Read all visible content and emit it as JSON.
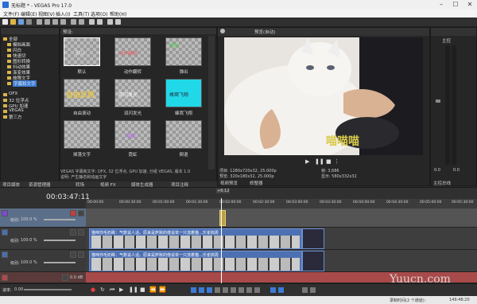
{
  "app": {
    "title": "无标题 * - VEGAS Pro 17.0"
  },
  "menu": [
    "文件(F)",
    "编辑(E)",
    "视图(V)",
    "插入(I)",
    "工具(T)",
    "选项(O)",
    "帮助(H)"
  ],
  "explorer": {
    "tree": [
      "全部",
      "模拟画面",
      "闪白",
      "快速切",
      "图形转换",
      "抖动效果",
      "渐变效果",
      "故障文字",
      "字幕和文字",
      "OFX",
      "32 位浮点",
      "GPU 加速",
      "VEGAS",
      "第三方"
    ],
    "info": "VEGAS 字幕和文字: OFX, 32 位浮点, GPU 加速, 分组 VEGAS, 版本 1.0",
    "info2": "说明: 产生静态和动画文字"
  },
  "presets": {
    "header": "预设:",
    "items": [
      {
        "label": "默认"
      },
      {
        "label": "动作翻转"
      },
      {
        "label": "弹出"
      },
      {
        "label": "自由滚动"
      },
      {
        "label": "双闪发光"
      },
      {
        "label": "蜂窝飞翔"
      },
      {
        "label": "掉落文字"
      },
      {
        "label": "霓虹"
      },
      {
        "label": "倒退"
      }
    ],
    "thumb_texts": [
      "默认",
      "动作翻转",
      "弹出",
      "自由反怒",
      "双闪发光",
      "蜂窝飞翔",
      "",
      "霓虹",
      ""
    ]
  },
  "left_tabs": [
    "项目媒体",
    "资源管理器",
    "转场",
    "视频 FX",
    "媒体生成器",
    "项目注释"
  ],
  "preview": {
    "mode_label": "预览(自动)",
    "caption": "喵喵喵",
    "project_label": "项目:",
    "project_value": "1280x720x32, 25.000p",
    "preview_label": "预览:",
    "preview_value": "320x180x32, 25.000p",
    "frame_label": "帧:",
    "frame_value": "3,686",
    "display_label": "显示:",
    "display_value": "580x332x32",
    "tabs": [
      "视频预览",
      "修整器"
    ]
  },
  "master": {
    "label": "主控",
    "value1": "0.0",
    "value2": "0.0",
    "tab": "主控总线"
  },
  "timeline": {
    "timecode": "00:03:47:11",
    "marker": "+6:12",
    "tracks": [
      {
        "level_label": "级别:",
        "level_value": "100.0 %",
        "type": "title"
      },
      {
        "level_label": "级别:",
        "level_value": "100.0 %",
        "type": "video"
      },
      {
        "level_label": "级别:",
        "level_value": "100.0 %",
        "type": "video"
      },
      {
        "level_label": "",
        "level_value": "0.0 dB",
        "type": "audio"
      }
    ],
    "clip_title": "猫咪你毛奶眸：气数说人话。原来是萨默的傍说单一只流着猫...乐雀搞周",
    "rate_label": "速率:",
    "rate_value": "0.00",
    "ruler_ticks": [
      "00:00:00",
      "00:00:30:00",
      "00:01:00:00",
      "00:01:30:00",
      "00:02:00:00",
      "00:02:30:00",
      "00:03:00:00",
      "00:03:30:00",
      "00:04:00:00",
      "00:04:30:00",
      "00:05:00:00",
      "00:05:30:00"
    ]
  },
  "statusbar": {
    "text": "录制时间(2 个通道)：",
    "time": "149:48:20"
  },
  "watermark": "Yuucn.com",
  "colors": {
    "accent": "#3b7bd6",
    "clip_blue": "#4d70b3",
    "audio_red": "#a84a4a",
    "caption": "#d8c94a"
  }
}
